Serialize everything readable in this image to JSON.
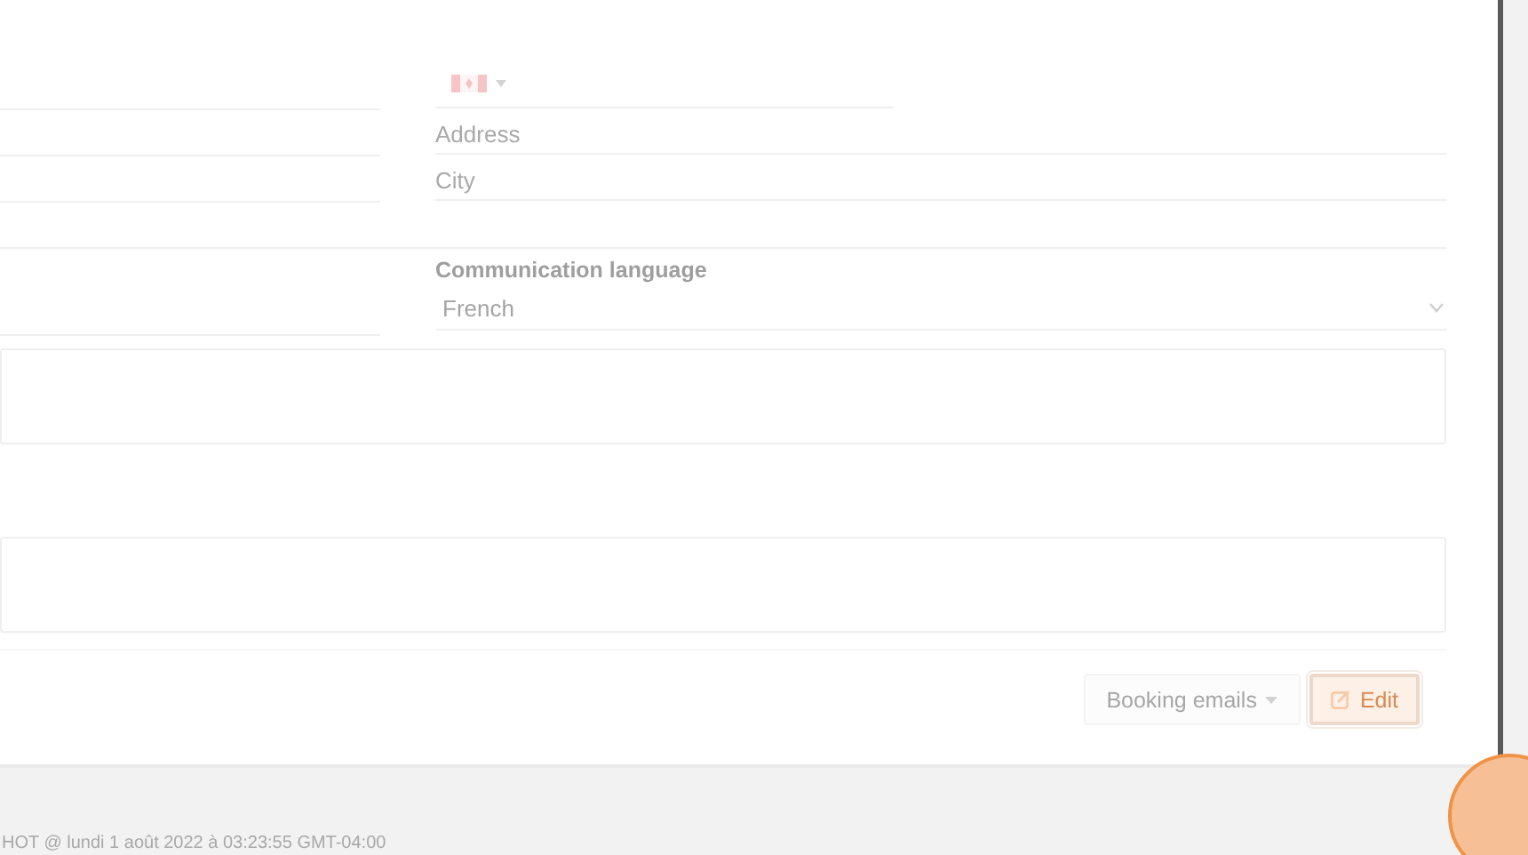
{
  "address_field": {
    "placeholder": "Address"
  },
  "city_field": {
    "placeholder": "City"
  },
  "communication_language": {
    "label": "Communication language",
    "value": "French"
  },
  "buttons": [
    {
      "label": "Booking emails",
      "kind": "dropdown"
    },
    {
      "label": "Edit",
      "kind": "edit"
    }
  ],
  "footer": {
    "text": "HOT @ lundi 1 août 2022 à 03:23:55 GMT-04:00"
  }
}
